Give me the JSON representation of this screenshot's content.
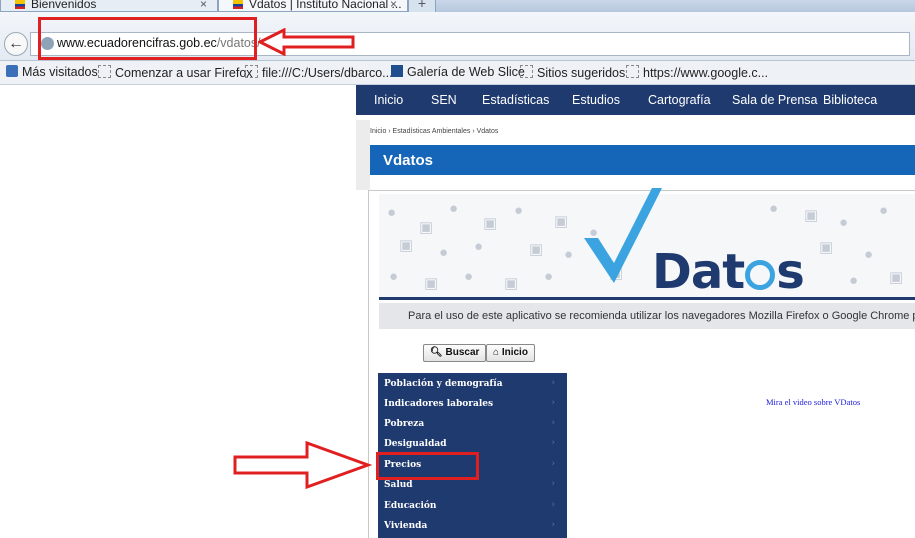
{
  "browser": {
    "tabs": [
      {
        "title": "Bienvenidos",
        "close": "×"
      },
      {
        "title": "Vdatos | Instituto Nacional ...",
        "close": "×"
      }
    ],
    "new_tab": "+",
    "url": {
      "host": "www.ecuadorencifras.gob.ec",
      "path": "/vdatos/"
    },
    "bookmarks": [
      "Más visitados",
      "Comenzar a usar Firefox",
      "file:///C:/Users/dbarco...",
      "Galería de Web Slice",
      "Sitios sugeridos",
      "https://www.google.c..."
    ]
  },
  "site": {
    "nav": [
      "Inicio",
      "SEN",
      "Estadísticas",
      "Estudios",
      "Cartografía",
      "Sala de Prensa",
      "Biblioteca"
    ],
    "breadcrumb": "Inicio  ›  Estadísticas Ambientales  ›  Vdatos",
    "page_title": "Vdatos"
  },
  "app": {
    "logo_text": "Dat",
    "logo_tail": "s",
    "notice": "Para el uso de este aplicativo se recomienda utilizar los navegadores Mozilla Firefox o Google Chrome para que tenga",
    "buttons": {
      "search": "Buscar",
      "home": "Inicio"
    },
    "menu": [
      "Población y demografía",
      "Indicadores laborales",
      "Pobreza",
      "Desigualdad",
      "Precios",
      "Salud",
      "Educación",
      "Vivienda"
    ],
    "video_link": "Mira el video sobre VDatos"
  },
  "colors": {
    "nav_bg": "#1f3a6f",
    "title_bg": "#1565b8",
    "annotation": "#e02020",
    "link": "#1a1adb"
  }
}
